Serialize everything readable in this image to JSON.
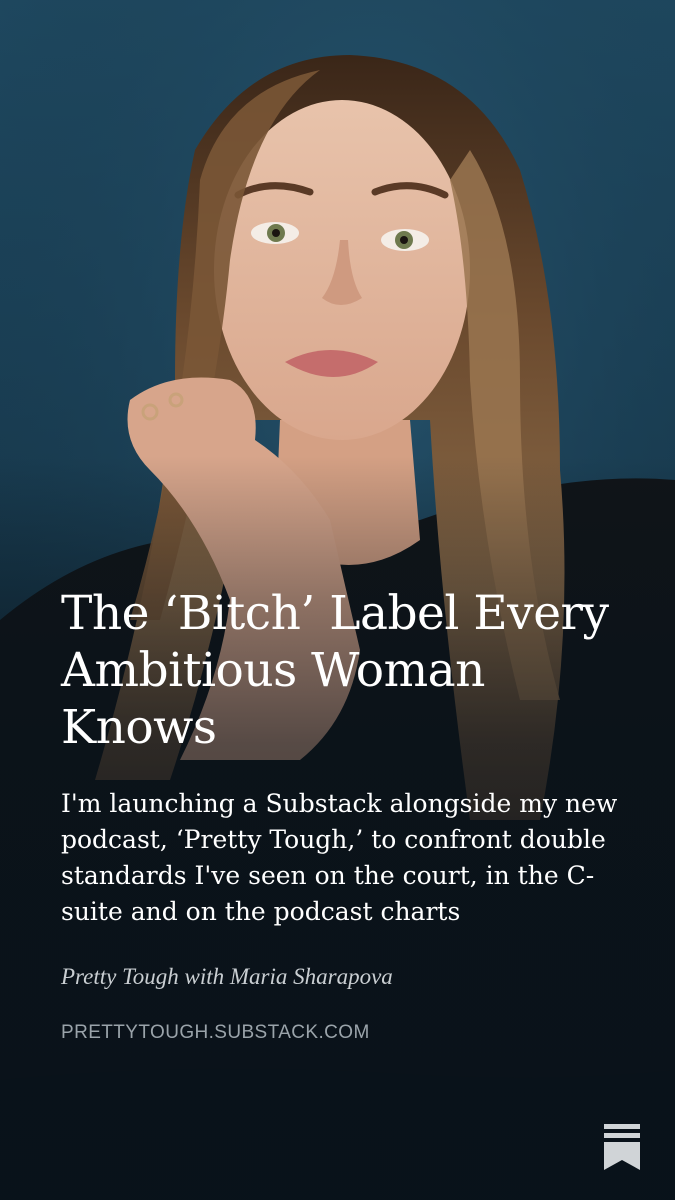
{
  "post": {
    "title": "The ‘Bitch’ Label Every Ambitious Woman Knows",
    "subtitle": "I'm launching a Substack alongside my new podcast, ‘Pretty Tough,’ to confront double standards I've seen on the court, in the C-suite and on the podcast charts",
    "publication": "Pretty Tough with Maria Sharapova",
    "domain": "PRETTYTOUGH.SUBSTACK.COM"
  },
  "brand": {
    "logo_icon": "substack-logo-icon",
    "logo_color": "#d0d4d7"
  },
  "theme": {
    "background": "#1a3f55",
    "title_color": "#ffffff",
    "byline_color": "#c9ced2",
    "domain_color": "#9aa3aa"
  }
}
